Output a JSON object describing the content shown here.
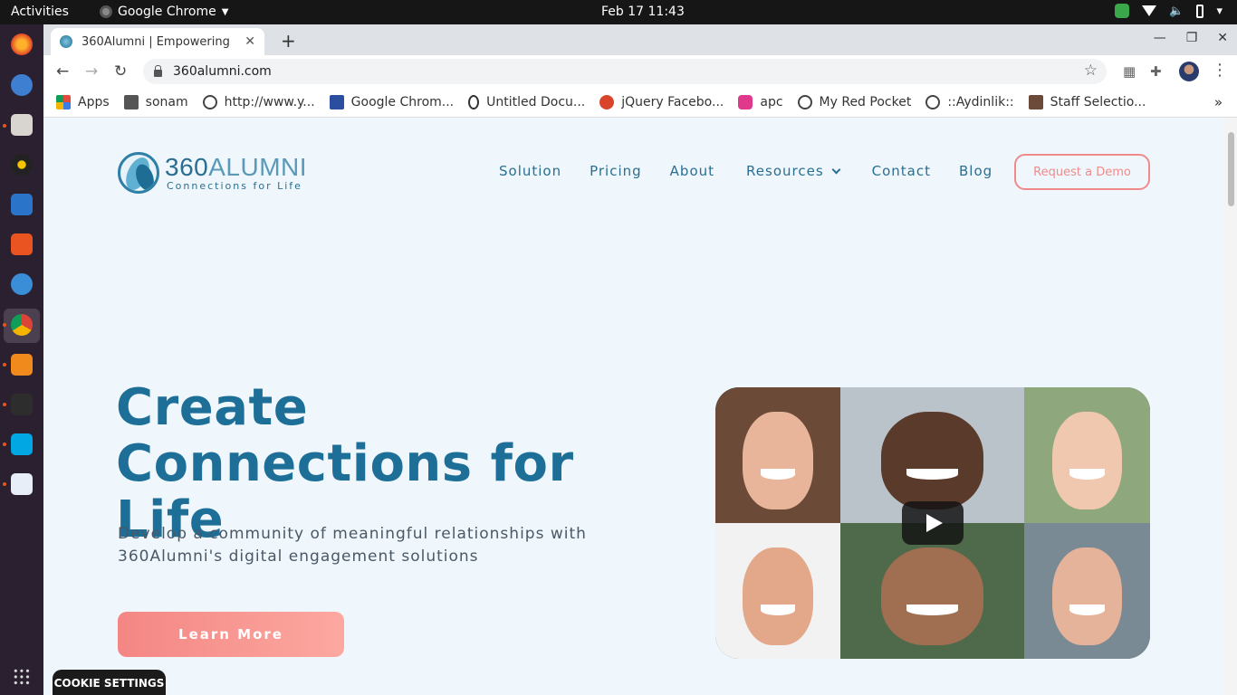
{
  "system": {
    "activities": "Activities",
    "app_name": "Google Chrome",
    "clock": "Feb 17  11:43"
  },
  "browser": {
    "tab_title": "360Alumni | Empowering",
    "url": "360alumni.com",
    "bookmarks": [
      {
        "label": "Apps",
        "icon_color": "#e24a3b"
      },
      {
        "label": "sonam",
        "icon_color": "#555555"
      },
      {
        "label": "http://www.y...",
        "icon_color": "#444444"
      },
      {
        "label": "Google Chrom...",
        "icon_color": "#2b4e9e"
      },
      {
        "label": "Untitled Docu...",
        "icon_color": "#333333"
      },
      {
        "label": "jQuery Facebo...",
        "icon_color": "#d9452b"
      },
      {
        "label": "apc",
        "icon_color": "#e0388b"
      },
      {
        "label": "My Red Pocket",
        "icon_color": "#444444"
      },
      {
        "label": "::Aydinlik::",
        "icon_color": "#444444"
      },
      {
        "label": "Staff Selectio...",
        "icon_color": "#6b4a3a"
      }
    ]
  },
  "site": {
    "logo": {
      "brand_bold": "360",
      "brand_thin": "ALUMNI",
      "tagline": "Connections for Life"
    },
    "nav": [
      "Solution",
      "Pricing",
      "About",
      "Resources",
      "Contact",
      "Blog"
    ],
    "demo_button": "Request a Demo",
    "hero": {
      "title": "Create Connections for Life",
      "subtitle": "Develop a community of meaningful relationships with 360Alumni's digital engagement solutions",
      "cta": "Learn More"
    },
    "cookie_settings": "COOKIE SETTINGS",
    "colors": {
      "brand_blue": "#1d6f98",
      "accent_coral": "#f48684",
      "page_bg": "#eff7fc"
    }
  }
}
